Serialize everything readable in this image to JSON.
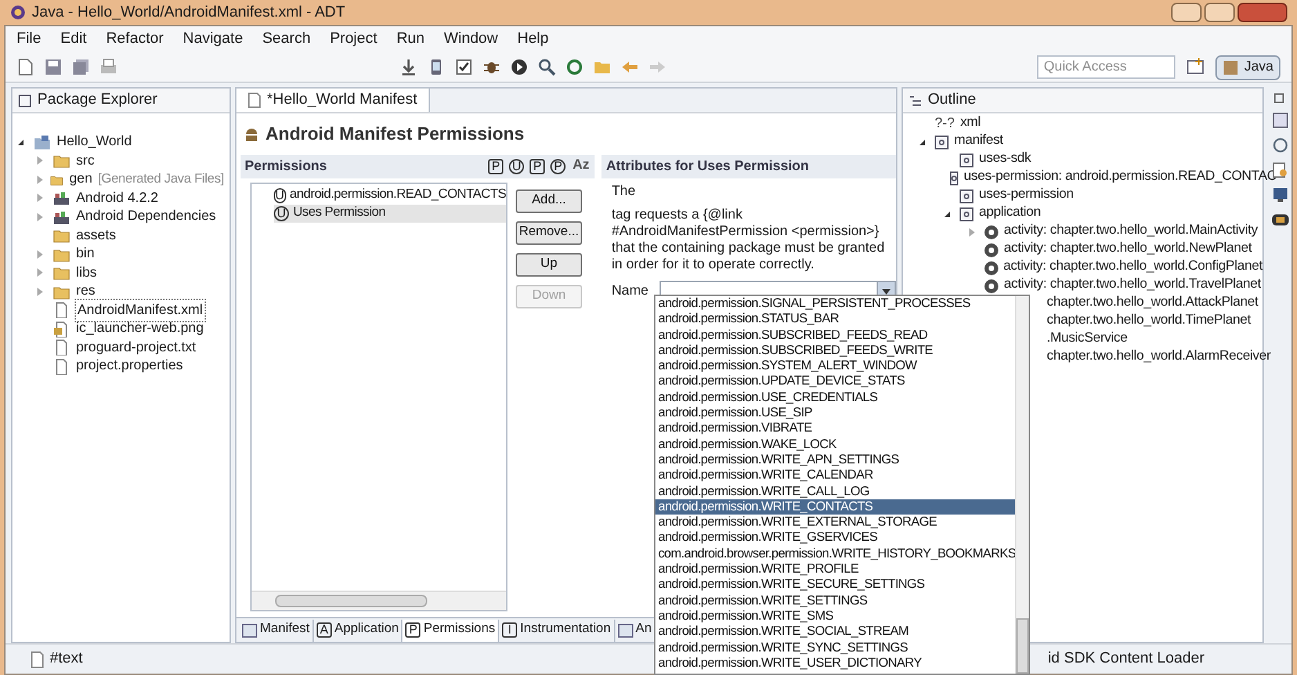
{
  "window": {
    "title": "Java - Hello_World/AndroidManifest.xml - ADT"
  },
  "menu": [
    "File",
    "Edit",
    "Refactor",
    "Navigate",
    "Search",
    "Project",
    "Run",
    "Window",
    "Help"
  ],
  "toolbar": {
    "quick_access": {
      "placeholder": "Quick Access"
    },
    "perspective": {
      "label": "Java",
      "selected": true
    }
  },
  "package_explorer": {
    "title": "Package Explorer",
    "tree": [
      {
        "label": "Hello_World",
        "kind": "project",
        "expanded": true,
        "children": [
          {
            "label": "src",
            "kind": "folder",
            "expanded": false
          },
          {
            "label": "gen",
            "note": "[Generated Java Files]",
            "kind": "folder",
            "expanded": false
          },
          {
            "label": "Android 4.2.2",
            "kind": "library",
            "expanded": false
          },
          {
            "label": "Android Dependencies",
            "kind": "library",
            "expanded": false
          },
          {
            "label": "assets",
            "kind": "folder"
          },
          {
            "label": "bin",
            "kind": "folder",
            "expanded": false
          },
          {
            "label": "libs",
            "kind": "folder",
            "expanded": false
          },
          {
            "label": "res",
            "kind": "folder",
            "expanded": false
          },
          {
            "label": "AndroidManifest.xml",
            "kind": "file",
            "selected": true
          },
          {
            "label": "ic_launcher-web.png",
            "kind": "image"
          },
          {
            "label": "proguard-project.txt",
            "kind": "file"
          },
          {
            "label": "project.properties",
            "kind": "file"
          }
        ]
      }
    ]
  },
  "editor": {
    "tab": {
      "label": "*Hello_World Manifest"
    },
    "heading": "Android Manifest Permissions",
    "permissions": {
      "title": "Permissions",
      "filters": [
        {
          "glyph": "P",
          "kind": "square"
        },
        {
          "glyph": "U",
          "kind": "circle"
        },
        {
          "glyph": "P",
          "kind": "square"
        },
        {
          "glyph": "P",
          "kind": "circle"
        },
        {
          "glyph": "Az",
          "kind": "sort"
        }
      ],
      "items": [
        {
          "glyph": "U",
          "label": "android.permission.READ_CONTACTS",
          "selected": false
        },
        {
          "glyph": "U",
          "label": "Uses Permission",
          "selected": true
        }
      ],
      "buttons": [
        {
          "label": "Add...",
          "disabled": false
        },
        {
          "label": "Remove...",
          "disabled": false
        },
        {
          "label": "Up",
          "disabled": false
        },
        {
          "label": "Down",
          "disabled": true
        }
      ]
    },
    "attributes": {
      "title": "Attributes for Uses Permission",
      "intro": "The",
      "description": "tag requests a {@link #AndroidManifestPermission <permission>} that the containing package must be granted in order for it to operate correctly.",
      "name_label": "Name",
      "options": [
        {
          "label": "android.permission.SIGNAL_PERSISTENT_PROCESSES",
          "selected": false
        },
        {
          "label": "android.permission.STATUS_BAR",
          "selected": false
        },
        {
          "label": "android.permission.SUBSCRIBED_FEEDS_READ",
          "selected": false
        },
        {
          "label": "android.permission.SUBSCRIBED_FEEDS_WRITE",
          "selected": false
        },
        {
          "label": "android.permission.SYSTEM_ALERT_WINDOW",
          "selected": false
        },
        {
          "label": "android.permission.UPDATE_DEVICE_STATS",
          "selected": false
        },
        {
          "label": "android.permission.USE_CREDENTIALS",
          "selected": false
        },
        {
          "label": "android.permission.USE_SIP",
          "selected": false
        },
        {
          "label": "android.permission.VIBRATE",
          "selected": false
        },
        {
          "label": "android.permission.WAKE_LOCK",
          "selected": false
        },
        {
          "label": "android.permission.WRITE_APN_SETTINGS",
          "selected": false
        },
        {
          "label": "android.permission.WRITE_CALENDAR",
          "selected": false
        },
        {
          "label": "android.permission.WRITE_CALL_LOG",
          "selected": false
        },
        {
          "label": "android.permission.WRITE_CONTACTS",
          "selected": true
        },
        {
          "label": "android.permission.WRITE_EXTERNAL_STORAGE",
          "selected": false
        },
        {
          "label": "android.permission.WRITE_GSERVICES",
          "selected": false
        },
        {
          "label": "com.android.browser.permission.WRITE_HISTORY_BOOKMARKS",
          "selected": false
        },
        {
          "label": "android.permission.WRITE_PROFILE",
          "selected": false
        },
        {
          "label": "android.permission.WRITE_SECURE_SETTINGS",
          "selected": false
        },
        {
          "label": "android.permission.WRITE_SETTINGS",
          "selected": false
        },
        {
          "label": "android.permission.WRITE_SMS",
          "selected": false
        },
        {
          "label": "android.permission.WRITE_SOCIAL_STREAM",
          "selected": false
        },
        {
          "label": "android.permission.WRITE_SYNC_SETTINGS",
          "selected": false
        },
        {
          "label": "android.permission.WRITE_USER_DICTIONARY",
          "selected": false
        }
      ]
    },
    "bottom_tabs": [
      {
        "label": "Manifest",
        "selected": false
      },
      {
        "glyph": "A",
        "label": "Application",
        "selected": false
      },
      {
        "glyph": "P",
        "label": "Permissions",
        "selected": true
      },
      {
        "glyph": "I",
        "label": "Instrumentation",
        "selected": false
      },
      {
        "label": "An",
        "selected": false
      }
    ]
  },
  "outline": {
    "title": "Outline",
    "tree": [
      {
        "marker": "?-?",
        "label": "xml",
        "kind": "plain"
      },
      {
        "label": "manifest",
        "kind": "element",
        "expanded": true,
        "children": [
          {
            "label": "uses-sdk",
            "kind": "element"
          },
          {
            "label": "uses-permission: android.permission.READ_CONTAC",
            "kind": "element"
          },
          {
            "label": "uses-permission",
            "kind": "element"
          },
          {
            "label": "application",
            "kind": "element",
            "expanded": true,
            "children": [
              {
                "label": "activity: chapter.two.hello_world.MainActivity",
                "kind": "activity",
                "expanded": false
              },
              {
                "label": "activity: chapter.two.hello_world.NewPlanet",
                "kind": "activity"
              },
              {
                "label": "activity: chapter.two.hello_world.ConfigPlanet",
                "kind": "activity"
              },
              {
                "label": "activity: chapter.two.hello_world.TravelPlanet",
                "kind": "activity"
              },
              {
                "label": "chapter.two.hello_world.AttackPlanet",
                "kind": "covered"
              },
              {
                "label": "chapter.two.hello_world.TimePlanet",
                "kind": "covered"
              },
              {
                "label": ".MusicService",
                "kind": "covered"
              },
              {
                "label": "chapter.two.hello_world.AlarmReceiver",
                "kind": "covered"
              }
            ]
          }
        ]
      }
    ]
  },
  "status_bar": {
    "selection": "#text",
    "job": "id SDK Content Loader"
  }
}
